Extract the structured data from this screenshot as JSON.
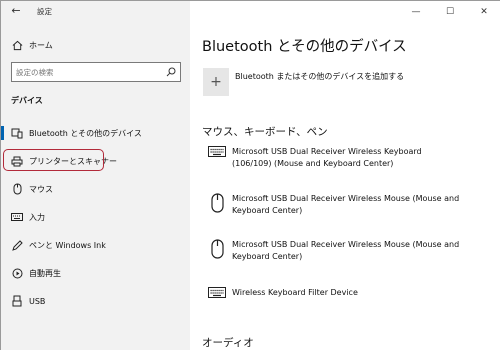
{
  "titlebar": {
    "back_icon": "back-arrow-icon",
    "title": "設定",
    "minimize": "—",
    "maximize": "☐",
    "close": "✕"
  },
  "sidebar": {
    "home_label": "ホーム",
    "search": {
      "placeholder": "設定の検索"
    },
    "section_title": "デバイス",
    "items": [
      {
        "label": "Bluetooth とその他のデバイス",
        "icon": "bluetooth-devices-icon",
        "active": true
      },
      {
        "label": "プリンターとスキャナー",
        "icon": "printer-icon",
        "highlighted": true
      },
      {
        "label": "マウス",
        "icon": "mouse-icon"
      },
      {
        "label": "入力",
        "icon": "keyboard-icon"
      },
      {
        "label": "ペンと Windows Ink",
        "icon": "pen-icon"
      },
      {
        "label": "自動再生",
        "icon": "autoplay-icon"
      },
      {
        "label": "USB",
        "icon": "usb-icon"
      }
    ]
  },
  "main": {
    "title": "Bluetooth とその他のデバイス",
    "add_device_label": "Bluetooth またはその他のデバイスを追加する",
    "section_mouse_keyboard": "マウス、キーボード、ペン",
    "devices": [
      {
        "name": "Microsoft USB Dual Receiver Wireless Keyboard (106/109) (Mouse and Keyboard Center)",
        "icon": "keyboard-icon"
      },
      {
        "name": "Microsoft USB Dual Receiver Wireless Mouse (Mouse and Keyboard Center)",
        "icon": "mouse-icon"
      },
      {
        "name": "Microsoft USB Dual Receiver Wireless Mouse (Mouse and Keyboard Center)",
        "icon": "mouse-icon"
      },
      {
        "name": "Wireless Keyboard Filter Device",
        "icon": "keyboard-icon"
      }
    ],
    "section_audio": "オーディオ"
  },
  "colors": {
    "accent": "#0063b1",
    "highlight_border": "#b22a3a",
    "sidebar_bg": "#f2f2f2"
  }
}
